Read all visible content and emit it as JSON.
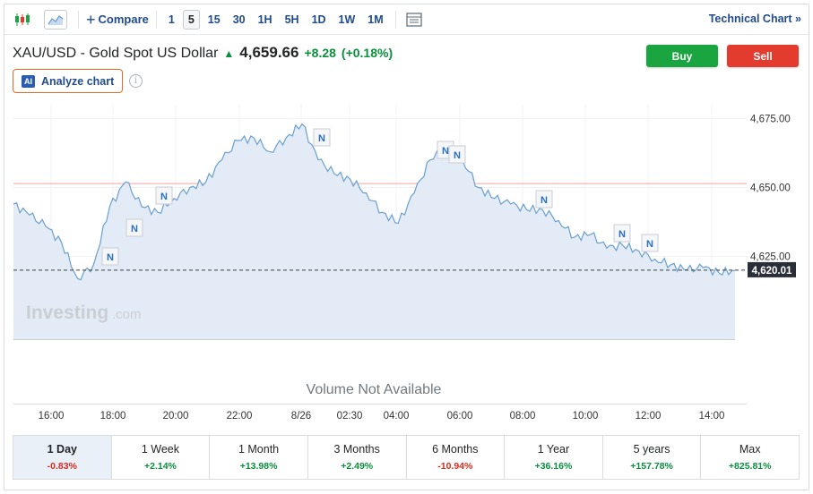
{
  "toolbar": {
    "compare_label": "Compare",
    "intervals": [
      "1",
      "5",
      "15",
      "30",
      "1H",
      "5H",
      "1D",
      "1W",
      "1M"
    ],
    "active_interval": "5",
    "technical_chart_label": "Technical Chart »"
  },
  "instrument": {
    "title": "XAU/USD - Gold Spot US Dollar",
    "price": "4,659.66",
    "change": "+8.28",
    "change_pct": "(+0.18%)"
  },
  "actions": {
    "buy_label": "Buy",
    "sell_label": "Sell",
    "analyze_label": "Analyze chart",
    "ai_badge": "AI",
    "info_glyph": "i"
  },
  "chart": {
    "watermark_brand": "Investing",
    "watermark_domain": ".com",
    "volume_note": "Volume Not Available",
    "current_price_label": "4,620.01",
    "news_marker": "N",
    "y_ticks": [
      "4,675.00",
      "4,650.00",
      "4,625.00"
    ],
    "x_ticks": [
      "16:00",
      "18:00",
      "20:00",
      "22:00",
      "8/26",
      "02:30",
      "04:00",
      "06:00",
      "08:00",
      "10:00",
      "12:00",
      "14:00"
    ]
  },
  "chart_data": {
    "type": "area",
    "series": [
      {
        "x": [
          "16:00",
          "16:30",
          "17:00",
          "17:30",
          "18:00",
          "18:30",
          "19:00",
          "19:30",
          "20:00",
          "20:30",
          "21:00",
          "21:30",
          "22:00",
          "22:30",
          "23:00",
          "23:30",
          "00:00",
          "00:30",
          "01:00",
          "01:30",
          "02:00",
          "02:30",
          "03:00",
          "03:30",
          "04:00",
          "04:30",
          "05:00",
          "05:30",
          "06:00",
          "06:30",
          "07:00",
          "07:30",
          "08:00",
          "08:30",
          "09:00",
          "09:30",
          "10:00",
          "10:30",
          "11:00",
          "11:30",
          "12:00",
          "12:30",
          "13:00",
          "13:30",
          "14:00",
          "14:30"
        ],
        "values": [
          4644,
          4640,
          4636,
          4630,
          4617,
          4622,
          4643,
          4652,
          4643,
          4641,
          4646,
          4650,
          4652,
          4660,
          4667,
          4668,
          4663,
          4668,
          4673,
          4660,
          4655,
          4653,
          4648,
          4641,
          4637,
          4648,
          4660,
          4664,
          4660,
          4650,
          4646,
          4644,
          4642,
          4642,
          4638,
          4632,
          4633,
          4628,
          4629,
          4627,
          4624,
          4622,
          4620,
          4621,
          4619,
          4620
        ]
      }
    ],
    "ylim": [
      4595,
      4680
    ],
    "reference_lines": {
      "previous_close": 4651.4,
      "current": 4620.01
    },
    "y_ticks": [
      4675,
      4650,
      4625
    ],
    "grid": true
  },
  "periods": [
    {
      "label": "1 Day",
      "value": "-0.83%",
      "direction": "neg",
      "active": true
    },
    {
      "label": "1 Week",
      "value": "+2.14%",
      "direction": "pos",
      "active": false
    },
    {
      "label": "1 Month",
      "value": "+13.98%",
      "direction": "pos",
      "active": false
    },
    {
      "label": "3 Months",
      "value": "+2.49%",
      "direction": "pos",
      "active": false
    },
    {
      "label": "6 Months",
      "value": "-10.94%",
      "direction": "neg",
      "active": false
    },
    {
      "label": "1 Year",
      "value": "+36.16%",
      "direction": "pos",
      "active": false
    },
    {
      "label": "5 years",
      "value": "+157.78%",
      "direction": "pos",
      "active": false
    },
    {
      "label": "Max",
      "value": "+825.81%",
      "direction": "pos",
      "active": false
    }
  ],
  "colors": {
    "accent": "#1f4b8e",
    "buy": "#1aa540",
    "sell": "#e33c2f",
    "line": "#6a9fd0",
    "fill": "#e3ecf6",
    "prev_close": "#f2a3a3"
  }
}
